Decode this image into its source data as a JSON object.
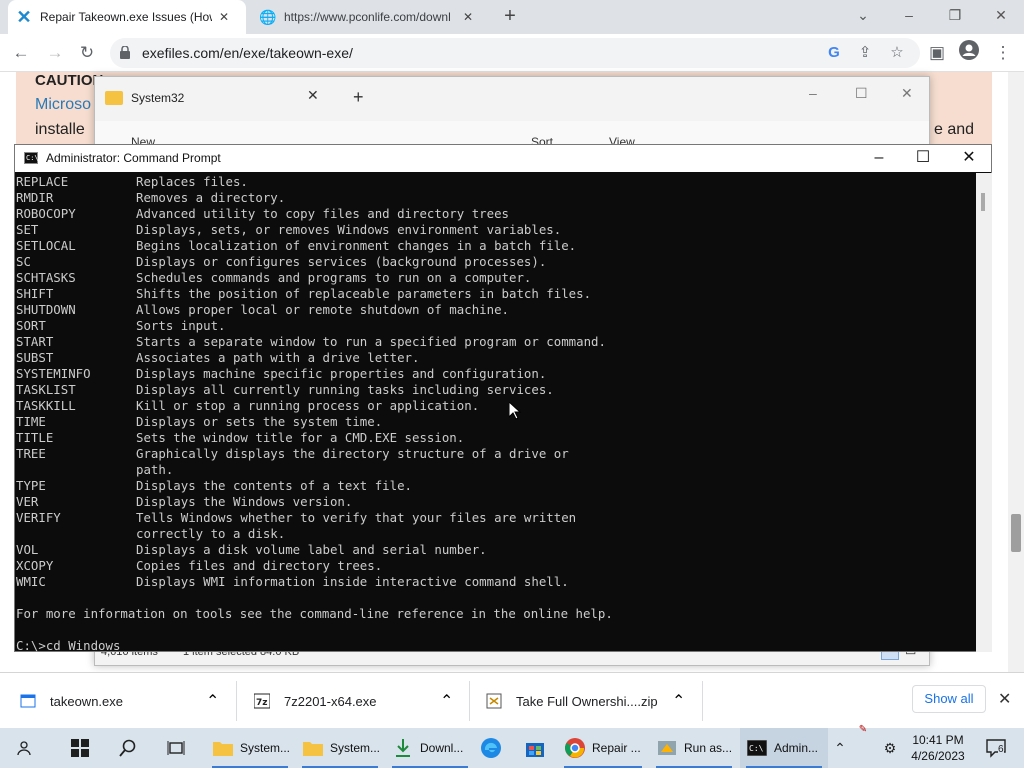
{
  "browser": {
    "tabs": [
      {
        "label": "Repair Takeown.exe Issues (How t",
        "active": true,
        "icon": "x-logo-icon"
      },
      {
        "label": "https://www.pconlife.com/downl",
        "active": false,
        "icon": "globe-icon"
      }
    ],
    "url": "exefiles.com/en/exe/takeown-exe/"
  },
  "webpage": {
    "caution": "CAUTION:",
    "line2": "Microso",
    "line3": "installe",
    "line3_end": "e and"
  },
  "explorer": {
    "title": "System32",
    "toolbar": {
      "new": "New",
      "sort": "Sort",
      "view": "View"
    },
    "status": {
      "items": "4,616 items",
      "selected": "1 item selected  84.0 KB"
    }
  },
  "cmd": {
    "title": "Administrator: Command Prompt",
    "commands": [
      {
        "name": "REPLACE",
        "desc": "Replaces files."
      },
      {
        "name": "RMDIR",
        "desc": "Removes a directory."
      },
      {
        "name": "ROBOCOPY",
        "desc": "Advanced utility to copy files and directory trees"
      },
      {
        "name": "SET",
        "desc": "Displays, sets, or removes Windows environment variables."
      },
      {
        "name": "SETLOCAL",
        "desc": "Begins localization of environment changes in a batch file."
      },
      {
        "name": "SC",
        "desc": "Displays or configures services (background processes)."
      },
      {
        "name": "SCHTASKS",
        "desc": "Schedules commands and programs to run on a computer."
      },
      {
        "name": "SHIFT",
        "desc": "Shifts the position of replaceable parameters in batch files."
      },
      {
        "name": "SHUTDOWN",
        "desc": "Allows proper local or remote shutdown of machine."
      },
      {
        "name": "SORT",
        "desc": "Sorts input."
      },
      {
        "name": "START",
        "desc": "Starts a separate window to run a specified program or command."
      },
      {
        "name": "SUBST",
        "desc": "Associates a path with a drive letter."
      },
      {
        "name": "SYSTEMINFO",
        "desc": "Displays machine specific properties and configuration."
      },
      {
        "name": "TASKLIST",
        "desc": "Displays all currently running tasks including services."
      },
      {
        "name": "TASKKILL",
        "desc": "Kill or stop a running process or application."
      },
      {
        "name": "TIME",
        "desc": "Displays or sets the system time."
      },
      {
        "name": "TITLE",
        "desc": "Sets the window title for a CMD.EXE session."
      },
      {
        "name": "TREE",
        "desc": "Graphically displays the directory structure of a drive or"
      },
      {
        "name": "",
        "desc": "path."
      },
      {
        "name": "TYPE",
        "desc": "Displays the contents of a text file."
      },
      {
        "name": "VER",
        "desc": "Displays the Windows version."
      },
      {
        "name": "VERIFY",
        "desc": "Tells Windows whether to verify that your files are written"
      },
      {
        "name": "",
        "desc": "correctly to a disk."
      },
      {
        "name": "VOL",
        "desc": "Displays a disk volume label and serial number."
      },
      {
        "name": "XCOPY",
        "desc": "Copies files and directory trees."
      },
      {
        "name": "WMIC",
        "desc": "Displays WMI information inside interactive command shell."
      }
    ],
    "footer": "For more information on tools see the command-line reference in the online help.",
    "prompt": "C:\\>cd Windows"
  },
  "downloads": {
    "items": [
      {
        "name": "takeown.exe",
        "icon": "exe-file-icon"
      },
      {
        "name": "7z2201-x64.exe",
        "icon": "7zip-icon"
      },
      {
        "name": "Take Full Ownershi....zip",
        "icon": "zip-file-icon"
      }
    ],
    "show_all": "Show all"
  },
  "taskbar": {
    "items": [
      {
        "label": "System...",
        "icon": "folder-icon"
      },
      {
        "label": "System...",
        "icon": "folder-icon"
      },
      {
        "label": "Downl...",
        "icon": "download-icon"
      },
      {
        "label": "",
        "icon": "edge-icon"
      },
      {
        "label": "",
        "icon": "store-icon"
      },
      {
        "label": "Repair ...",
        "icon": "chrome-icon"
      },
      {
        "label": "Run as...",
        "icon": "app-icon"
      },
      {
        "label": "Admin...",
        "icon": "cmd-icon"
      }
    ],
    "time": "10:41 PM",
    "date": "4/26/2023",
    "notifications": "6"
  },
  "colors": {
    "accent": "#1a73e8",
    "console_bg": "#0c0c0c",
    "console_text": "#cccccc",
    "caution_bg": "#f6ddd0"
  }
}
